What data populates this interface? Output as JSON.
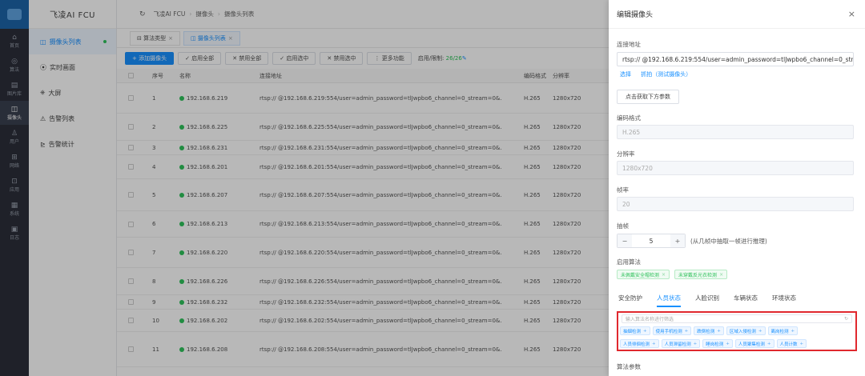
{
  "rail": {
    "items": [
      {
        "label": "首页",
        "icon": "home-icon",
        "glyph": "⌂"
      },
      {
        "label": "算法",
        "icon": "algorithm-icon",
        "glyph": "◎"
      },
      {
        "label": "图片库",
        "icon": "image-library-icon",
        "glyph": "▤"
      },
      {
        "label": "摄像头",
        "icon": "camera-icon",
        "glyph": "◫"
      },
      {
        "label": "用户",
        "icon": "user-icon",
        "glyph": "♙"
      },
      {
        "label": "网络",
        "icon": "network-icon",
        "glyph": "⊞"
      },
      {
        "label": "应用",
        "icon": "app-icon",
        "glyph": "⊡"
      },
      {
        "label": "系统",
        "icon": "system-icon",
        "glyph": "▦"
      },
      {
        "label": "日志",
        "icon": "log-icon",
        "glyph": "▣"
      }
    ]
  },
  "menu": {
    "title": "飞凌AI FCU",
    "items": [
      {
        "label": "摄像头列表",
        "glyph": "◫"
      },
      {
        "label": "实时画面",
        "glyph": "⦿"
      },
      {
        "label": "大屏",
        "glyph": "⎈"
      },
      {
        "label": "告警列表",
        "glyph": "⚠"
      },
      {
        "label": "告警统计",
        "glyph": "⊵"
      }
    ]
  },
  "breadcrumb": [
    "飞凌AI FCU",
    "摄像头",
    "摄像头列表"
  ],
  "tabs": [
    {
      "label": "算法类型",
      "glyph": "⊟"
    },
    {
      "label": "摄像头列表",
      "glyph": "◫"
    }
  ],
  "toolbar": {
    "add": "+ 添加摄像头",
    "enable_all": "✓ 启用全部",
    "disable_all": "✕ 禁用全部",
    "enable_sel": "✓ 启用选中",
    "disable_sel": "✕ 禁用选中",
    "more": "⋮ 更多功能",
    "limit_label": "启用/限制:",
    "limit_value": "26/26",
    "limit_pen": "✎"
  },
  "table": {
    "headers": {
      "no": "序号",
      "name": "名称",
      "url": "连接地址",
      "codec": "编码格式",
      "res": "分辨率"
    },
    "rows": [
      {
        "no": "1",
        "name": "192.168.6.219",
        "url": "rtsp:// @192.168.6.219:554/user=admin_password=tlJwpbo6_channel=0_stream=0&.",
        "codec": "H.265",
        "res": "1280x720"
      },
      {
        "no": "2",
        "name": "192.168.6.225",
        "url": "rtsp:// @192.168.6.225:554/user=admin_password=tlJwpbo6_channel=0_stream=0&.",
        "codec": "H.265",
        "res": "1280x720"
      },
      {
        "no": "3",
        "name": "192.168.6.231",
        "url": "rtsp:// @192.168.6.231:554/user=admin_password=tlJwpbo6_channel=0_stream=0&.",
        "codec": "H.265",
        "res": "1280x720"
      },
      {
        "no": "4",
        "name": "192.168.6.201",
        "url": "rtsp:// @192.168.6.201:554/user=admin_password=tlJwpbo6_channel=0_stream=0&.",
        "codec": "H.265",
        "res": "1280x720"
      },
      {
        "no": "5",
        "name": "192.168.6.207",
        "url": "rtsp:// @192.168.6.207:554/user=admin_password=tlJwpbo6_channel=0_stream=0&.",
        "codec": "H.265",
        "res": "1280x720"
      },
      {
        "no": "6",
        "name": "192.168.6.213",
        "url": "rtsp:// @192.168.6.213:554/user=admin_password=tlJwpbo6_channel=0_stream=0&.",
        "codec": "H.265",
        "res": "1280x720"
      },
      {
        "no": "7",
        "name": "192.168.6.220",
        "url": "rtsp:// @192.168.6.220:554/user=admin_password=tlJwpbo6_channel=0_stream=0&.",
        "codec": "H.265",
        "res": "1280x720"
      },
      {
        "no": "8",
        "name": "192.168.6.226",
        "url": "rtsp:// @192.168.6.226:554/user=admin_password=tlJwpbo6_channel=0_stream=0&.",
        "codec": "H.265",
        "res": "1280x720"
      },
      {
        "no": "9",
        "name": "192.168.6.232",
        "url": "rtsp:// @192.168.6.232:554/user=admin_password=tlJwpbo6_channel=0_stream=0&.",
        "codec": "H.265",
        "res": "1280x720"
      },
      {
        "no": "10",
        "name": "192.168.6.202",
        "url": "rtsp:// @192.168.6.202:554/user=admin_password=tlJwpbo6_channel=0_stream=0&.",
        "codec": "H.265",
        "res": "1280x720"
      },
      {
        "no": "11",
        "name": "192.168.6.208",
        "url": "rtsp:// @192.168.6.208:554/user=admin_password=tlJwpbo6_channel=0_stream=0&.",
        "codec": "H.265",
        "res": "1280x720"
      }
    ]
  },
  "drawer": {
    "title": "编辑摄像头",
    "close": "×",
    "url_label": "连接地址",
    "url_value": "rtsp:// @192.168.6.219:554/user=admin_password=tlJwpbo6_channel=0_stream",
    "link_select": "选择",
    "link_snapshot": "抓拍（测试摄像头）",
    "fetch_button": "点击获取下方参数",
    "codec_label": "编码格式",
    "codec_value": "H.265",
    "res_label": "分辨率",
    "res_value": "1280x720",
    "fps_label": "帧率",
    "fps_value": "20",
    "skip_label": "抽帧",
    "skip_value": "5",
    "skip_hint": "(从几帧中抽取一帧进行推理)",
    "algo_label": "启用算法",
    "enabled_algos": [
      "未佩戴安全帽检测",
      "未穿戴反光衣检测"
    ],
    "category_tabs": [
      "安全防护",
      "人员状态",
      "人脸识别",
      "车辆状态",
      "环境状态"
    ],
    "filter_placeholder": "输入算法名称进行筛选",
    "available_row1": [
      "抽烟检测",
      "使用手机检测",
      "跌倒检测",
      "区域入侵检测",
      "离岗检测"
    ],
    "available_row2": [
      "人员徘徊检测",
      "人员滞留检测",
      "睡岗检测",
      "人员聚集检测",
      "人员计数"
    ],
    "params_label": "算法参数"
  },
  "colors": {
    "primary": "#1890ff",
    "success": "#2fc25b",
    "highlight": "#e0282e",
    "rail": "#2b2f3a"
  }
}
